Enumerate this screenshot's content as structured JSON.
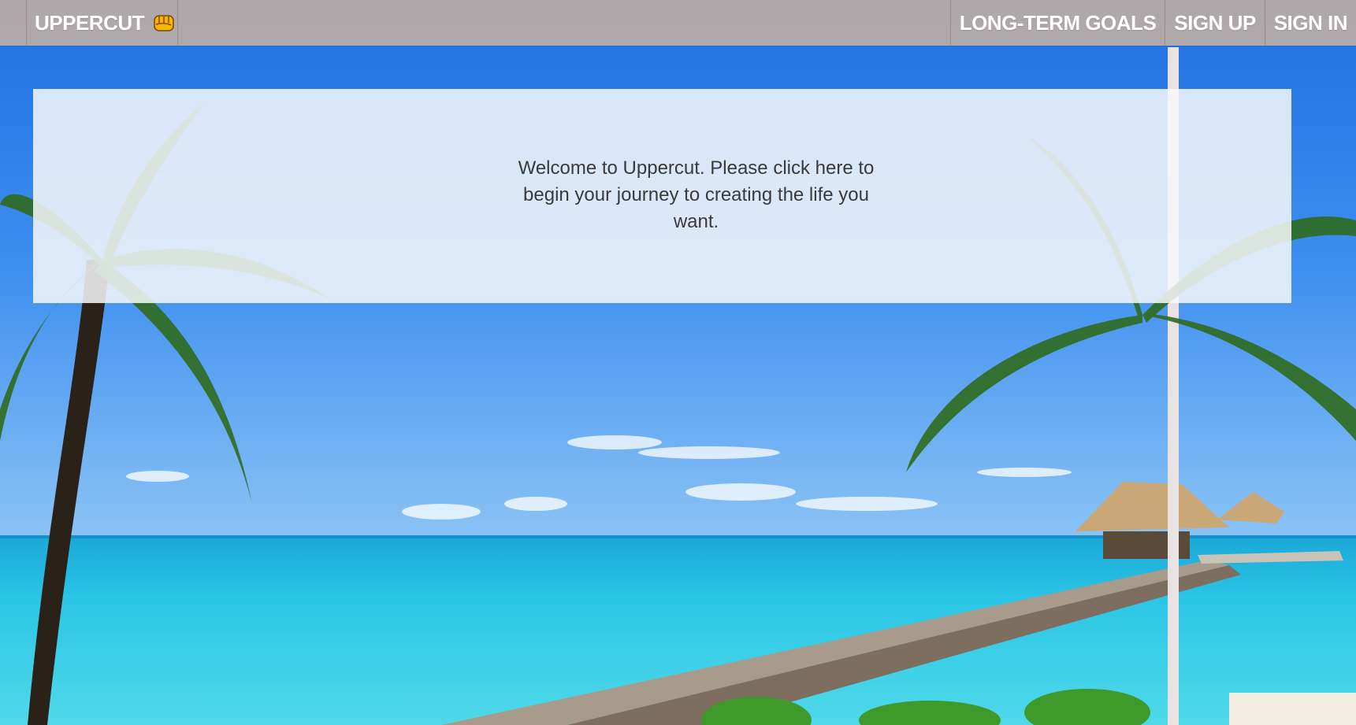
{
  "navbar": {
    "brand": {
      "label": "UPPERCUT",
      "icon": "fist-emoji-icon"
    },
    "links": [
      {
        "label": "LONG-TERM GOALS"
      },
      {
        "label": "SIGN UP"
      },
      {
        "label": "SIGN IN"
      }
    ],
    "background_color": "#e6be96"
  },
  "welcome_panel": {
    "message": "Welcome to Uppercut. Please click here to begin your journey to creating the life you want."
  },
  "background": {
    "image": "tropical-beach-pier-palm-trees"
  }
}
